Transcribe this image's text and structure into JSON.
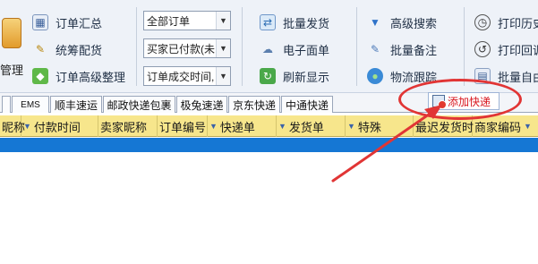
{
  "toolbar": {
    "manage_label": "管理",
    "col1": [
      "订单汇总",
      "统筹配货",
      "订单高级整理"
    ],
    "selects": [
      "全部订单",
      "买家已付款(未",
      "订单成交时间,"
    ],
    "col3": [
      "批量发货",
      "电子面单",
      "刷新显示"
    ],
    "col4": [
      "高级搜索",
      "批量备注",
      "物流跟踪"
    ],
    "col5": [
      "打印历史",
      "打印回调",
      "批量自由"
    ]
  },
  "tabs": [
    "EMS",
    "顺丰速运",
    "邮政快递包裹",
    "极兔速递",
    "京东快递",
    "中通快递"
  ],
  "add_express_label": "添加快递",
  "columns": [
    "昵称",
    "付款时间",
    "卖家昵称",
    "订单编号",
    "快递单",
    "发货单",
    "特殊",
    "最迟发货时",
    "商家编码"
  ],
  "colors": {
    "toolbar_bg": "#eef2f8",
    "header_yellow": "#f7e68c",
    "selection_blue": "#1577d4",
    "annotation_red": "#e13535"
  }
}
